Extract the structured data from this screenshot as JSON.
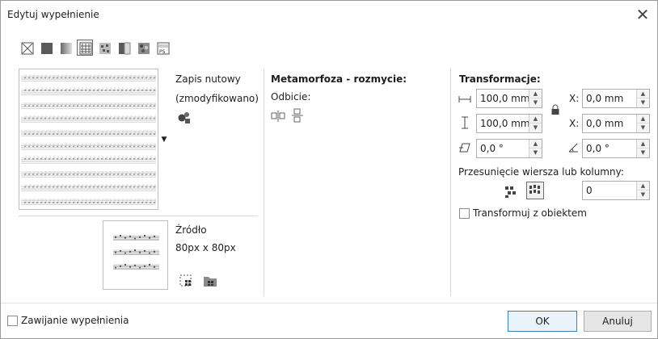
{
  "dialog": {
    "title": "Edytuj wypełnienie",
    "close_icon": "close-icon"
  },
  "toolbar": {
    "buttons": [
      {
        "name": "no-fill-icon",
        "active": false
      },
      {
        "name": "uniform-fill-icon",
        "active": false
      },
      {
        "name": "fountain-fill-icon",
        "active": false
      },
      {
        "name": "vector-pattern-fill-icon",
        "active": true
      },
      {
        "name": "bitmap-pattern-fill-icon",
        "active": false
      },
      {
        "name": "two-color-pattern-fill-icon",
        "active": false
      },
      {
        "name": "texture-fill-icon",
        "active": false
      },
      {
        "name": "postscript-fill-icon",
        "active": false
      }
    ]
  },
  "pattern": {
    "name_line1": "Zapis nutowy",
    "name_line2": "(zmodyfikowano)"
  },
  "source": {
    "label": "Źródło",
    "size": "80px x 80px"
  },
  "metamorphosis": {
    "title": "Metamorfoza - rozmycie:",
    "mirror_label": "Odbicie:"
  },
  "transform": {
    "title": "Transformacje:",
    "width": "100,0 mm",
    "height": "100,0 mm",
    "x": "0,0 mm",
    "y": "0,0 mm",
    "x_label": "X:",
    "y_label": "X:",
    "skew": "0,0 °",
    "rotate": "0,0 °",
    "offset_label": "Przesunięcie wiersza lub kolumny:",
    "offset_value": "0",
    "transform_with_object": "Transformuj z obiektem"
  },
  "footer": {
    "wrap_fill": "Zawijanie wypełnienia",
    "ok": "OK",
    "cancel": "Anuluj"
  },
  "colors": {
    "accent": "#3c7fb1",
    "border": "#adadad"
  }
}
